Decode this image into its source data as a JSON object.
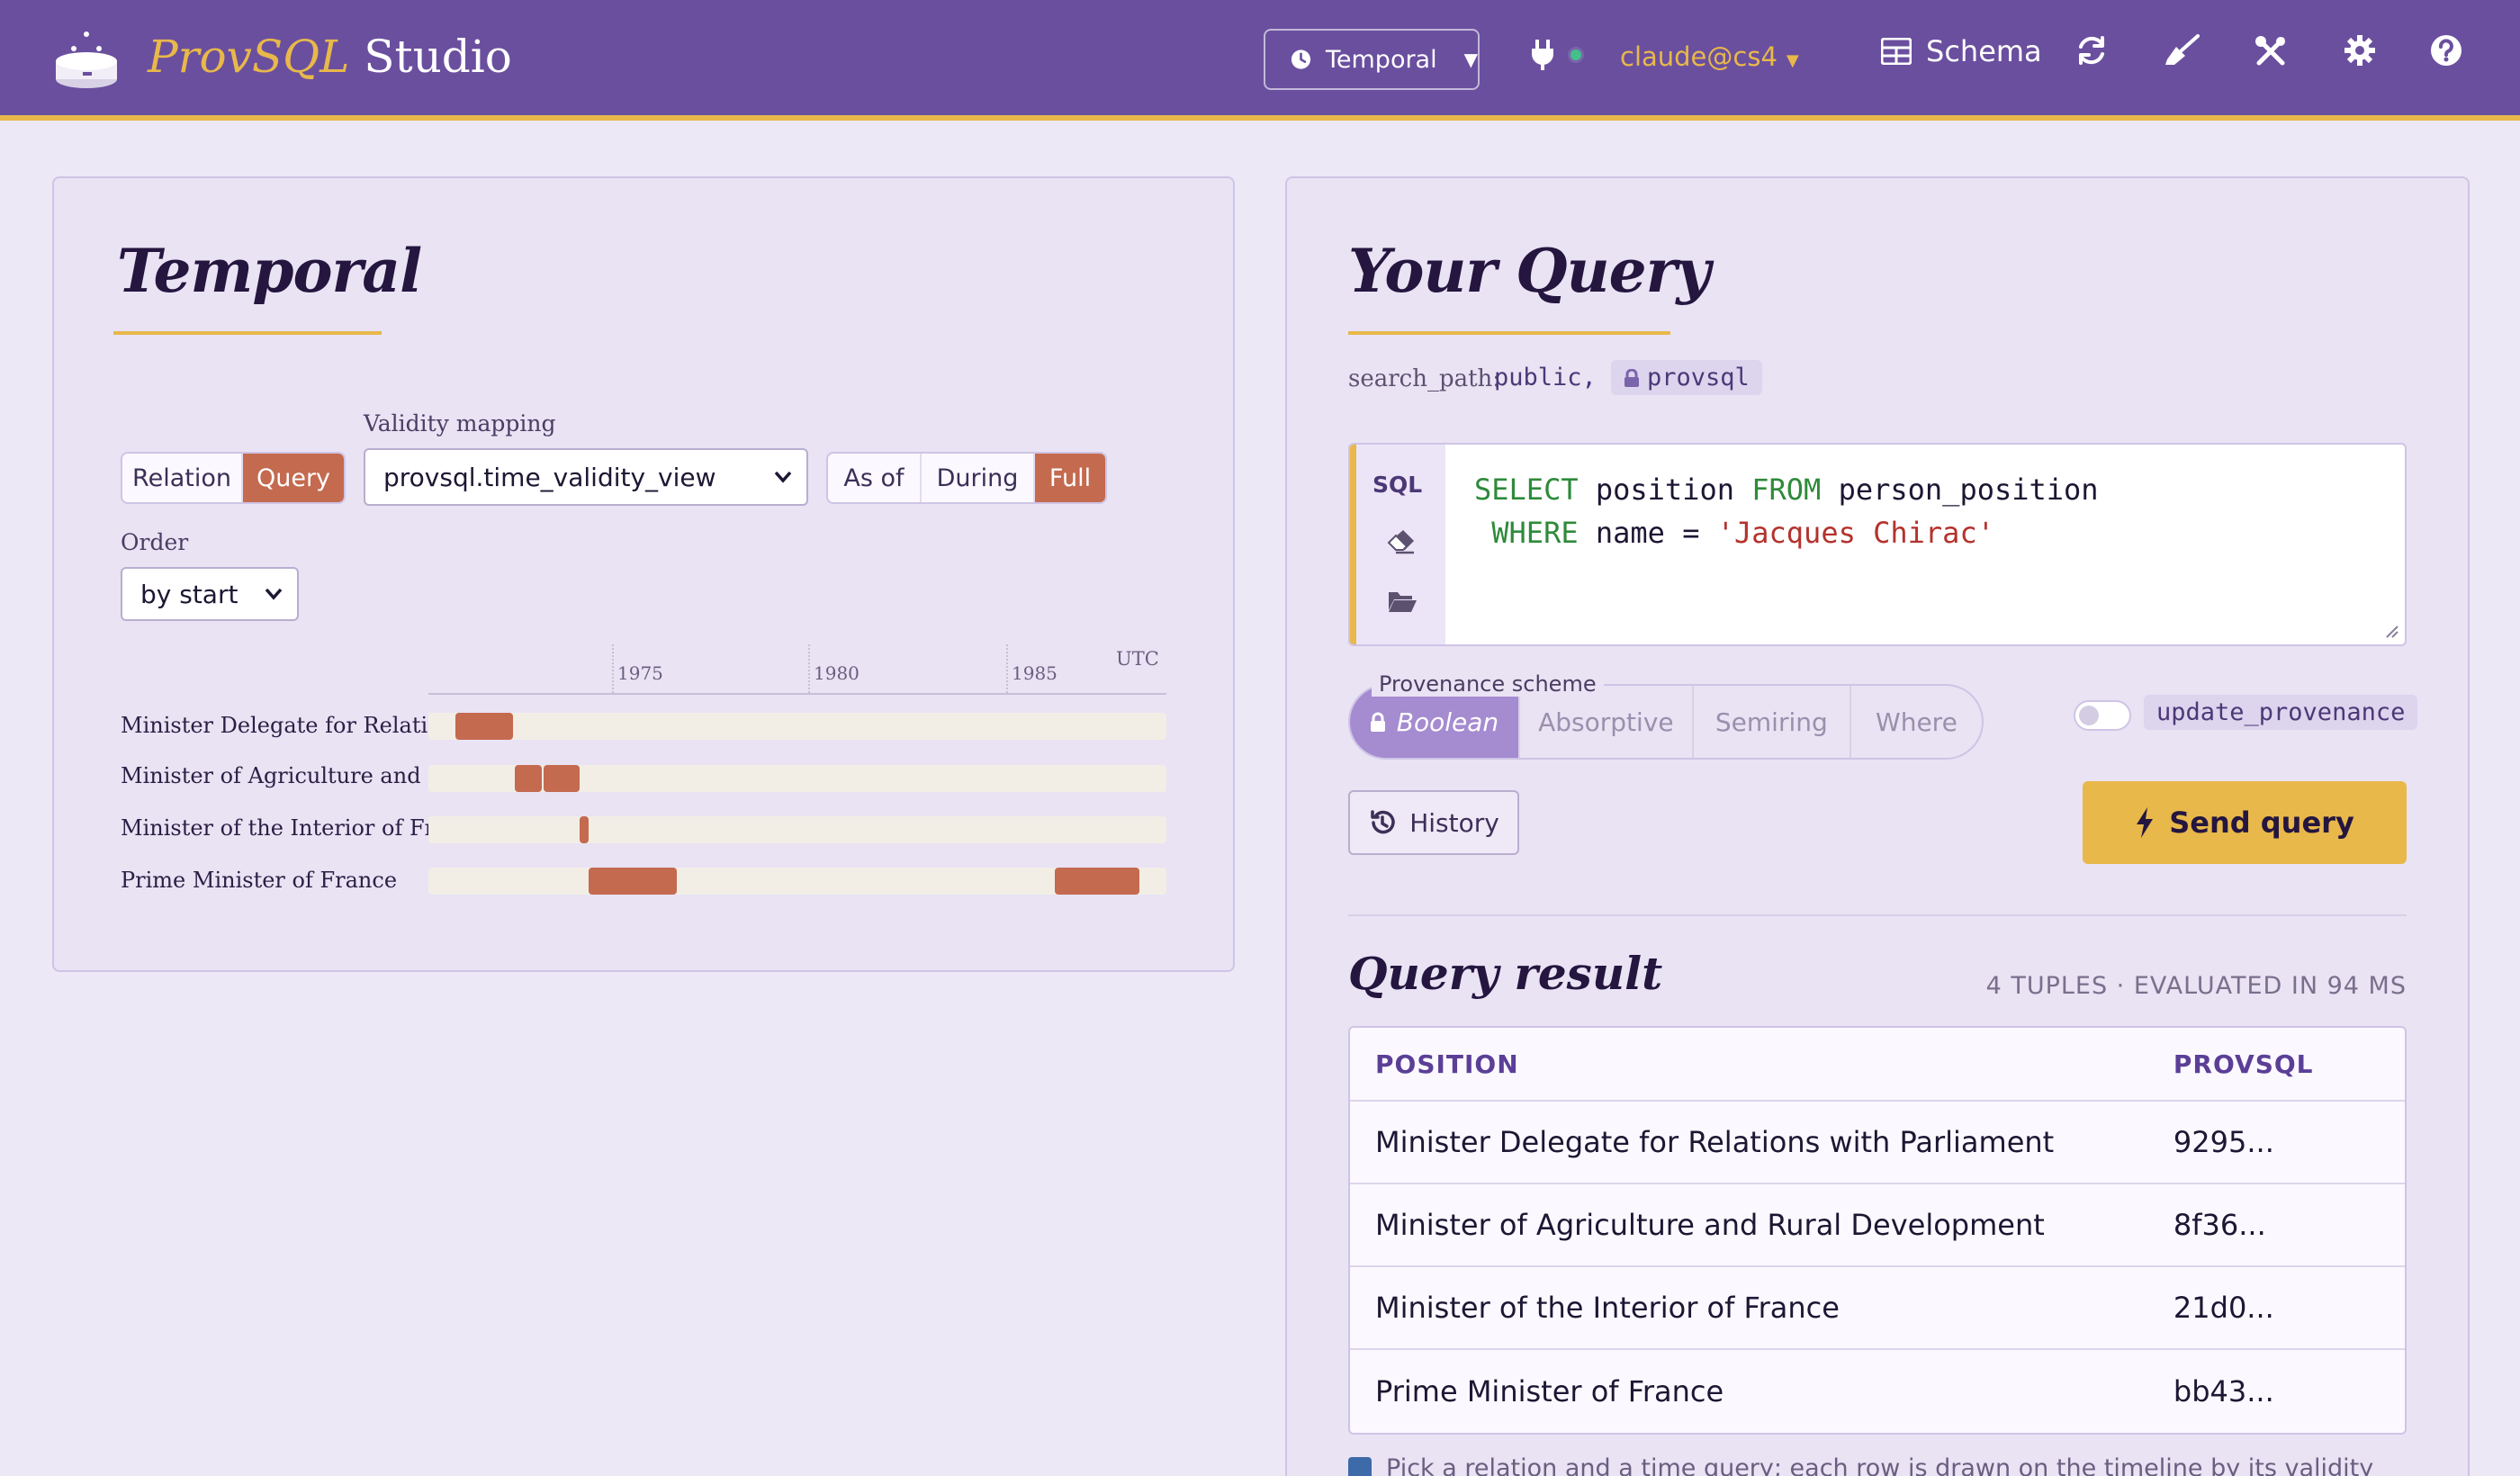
{
  "app": {
    "brand_prefix": "ProvSQL",
    "brand_suffix": "Studio"
  },
  "topbar": {
    "mode": "Temporal",
    "user": "claude@cs4",
    "schema_label": "Schema",
    "icons": [
      "clock-icon",
      "plug-icon",
      "table-icon",
      "refresh-icon",
      "broom-icon",
      "tools-icon",
      "gear-icon",
      "help-icon"
    ]
  },
  "temporal": {
    "title": "Temporal",
    "source_tabs": [
      {
        "label": "Relation",
        "selected": false
      },
      {
        "label": "Query",
        "selected": true
      }
    ],
    "validity_label": "Validity mapping",
    "validity_value": "provsql.time_validity_view",
    "time_modes": [
      {
        "label": "As of",
        "selected": false
      },
      {
        "label": "During",
        "selected": false
      },
      {
        "label": "Full",
        "selected": true
      }
    ],
    "order_label": "Order",
    "order_value": "by start",
    "timezone": "UTC",
    "axis_ticks": [
      "1975",
      "1980",
      "1985"
    ],
    "rows": [
      {
        "label": "Minister Delegate for Relatio..."
      },
      {
        "label": "Minister of Agriculture and ..."
      },
      {
        "label": "Minister of the Interior of Fra..."
      },
      {
        "label": "Prime Minister of France"
      }
    ],
    "bar_color": "#c46a4f"
  },
  "query": {
    "title": "Your Query",
    "search_path_label": "search_path:",
    "search_path_public": "public,",
    "search_path_provsql": "provsql",
    "gutter_label": "SQL",
    "sql_line1": {
      "kw1": "SELECT",
      "t1": " position ",
      "kw2": "FROM",
      "t2": " person_position"
    },
    "sql_line2": {
      "kw1": " WHERE",
      "t1": " name = ",
      "str": "'Jacques Chirac'"
    },
    "scheme_legend": "Provenance scheme",
    "schemes": [
      {
        "label": "Boolean",
        "selected": true
      },
      {
        "label": "Absorptive",
        "selected": false
      },
      {
        "label": "Semiring",
        "selected": false
      },
      {
        "label": "Where",
        "selected": false
      }
    ],
    "update_provenance_label": "update_provenance",
    "update_provenance_on": false,
    "history_label": "History",
    "send_label": "Send query"
  },
  "result": {
    "title": "Query result",
    "meta": "4 TUPLES · EVALUATED IN 94 MS",
    "columns": [
      "POSITION",
      "PROVSQL"
    ],
    "rows": [
      [
        "Minister Delegate for Relations with Parliament",
        "9295..."
      ],
      [
        "Minister of Agriculture and Rural Development",
        "8f36..."
      ],
      [
        "Minister of the Interior of France",
        "21d0..."
      ],
      [
        "Prime Minister of France",
        "bb43..."
      ]
    ],
    "hint": "Pick a relation and a time query; each row is drawn on the timeline by its validity"
  },
  "colors": {
    "header": "#6a4f9f",
    "accent": "#e8b84a",
    "bar": "#c46a4f",
    "scheme_active": "#a58bd0"
  }
}
